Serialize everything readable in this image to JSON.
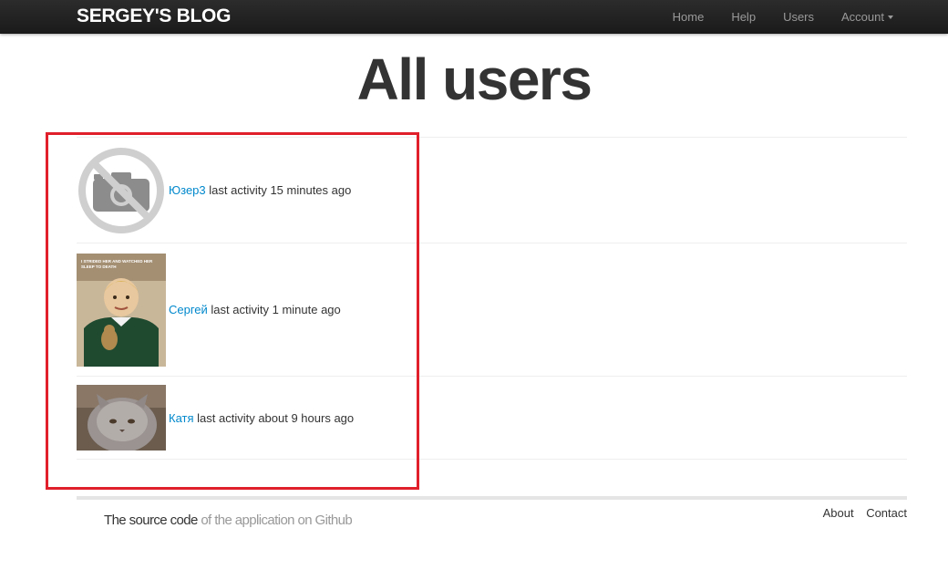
{
  "navbar": {
    "brand": "SERGEY'S BLOG",
    "links": [
      "Home",
      "Help",
      "Users"
    ],
    "account_label": "Account"
  },
  "page": {
    "title": "All users"
  },
  "users": [
    {
      "name": "Юзер3",
      "activity": "last activity 15 minutes ago",
      "avatar": "no-photo-icon"
    },
    {
      "name": "Сергей",
      "activity": "last activity 1 minute ago",
      "avatar": "child-meme-photo",
      "avatar_caption": "I STRIDED HER AND WATCHED HER SLEEP TO DEATH"
    },
    {
      "name": "Катя",
      "activity": "last activity about 9 hours ago",
      "avatar": "grey-cat-photo"
    }
  ],
  "footer": {
    "source_prefix": "The source code",
    "source_link": "of the application on Github",
    "links": [
      "About",
      "Contact"
    ]
  },
  "colors": {
    "navbar": "#1b1b1b",
    "link": "#0088cc",
    "highlight_box": "#e0202b"
  }
}
